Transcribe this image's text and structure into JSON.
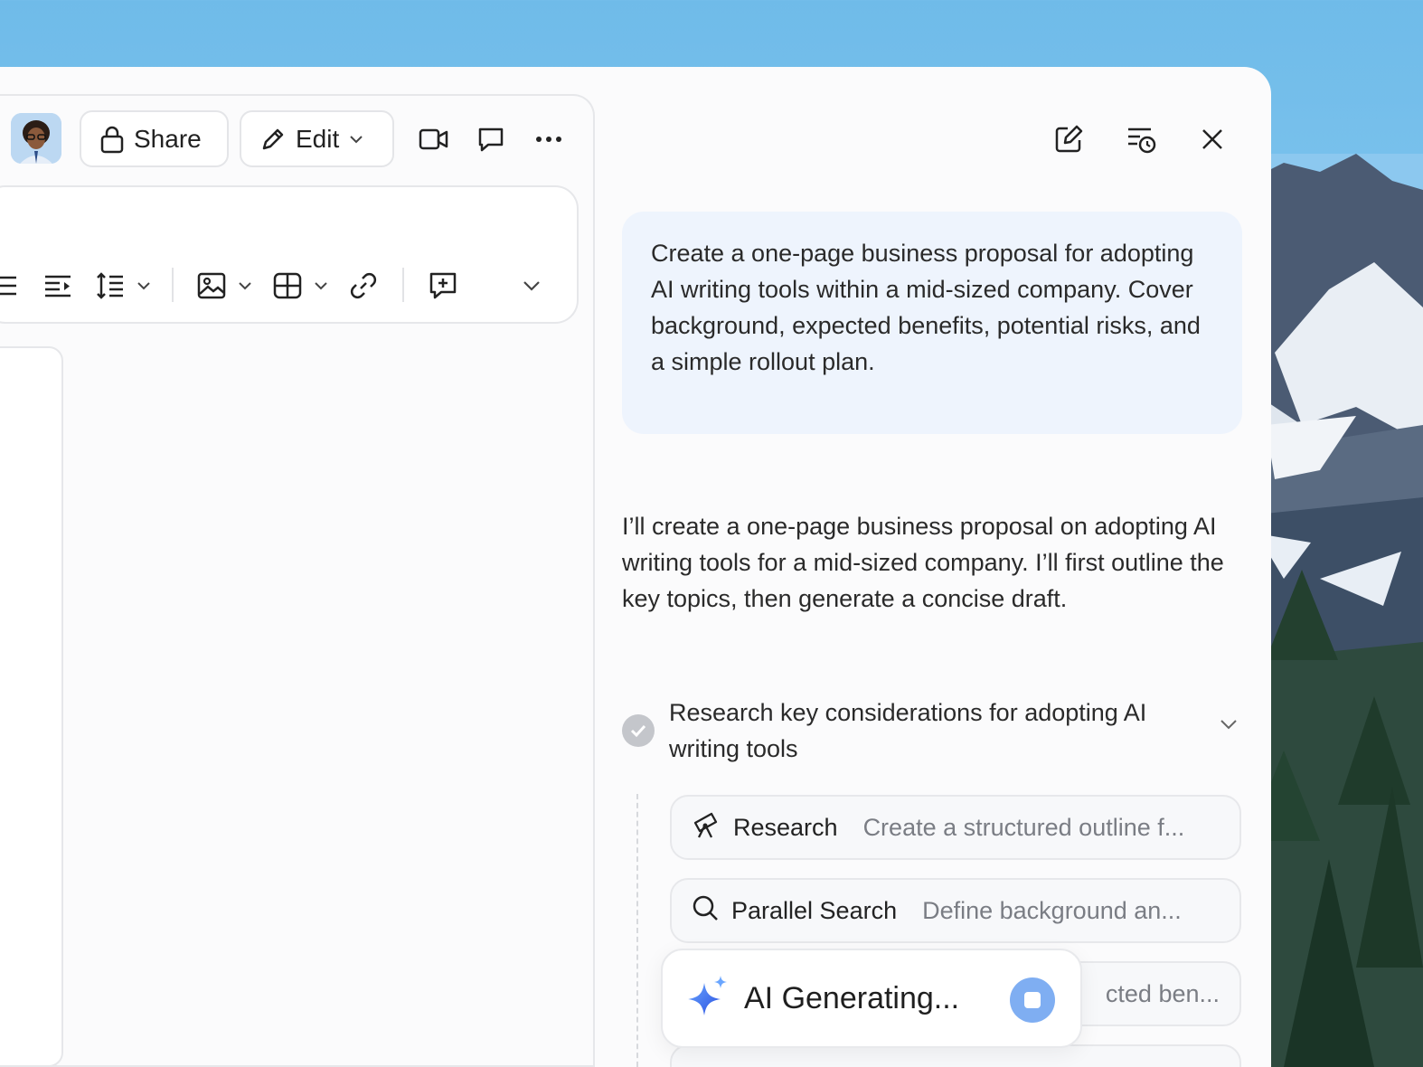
{
  "editor": {
    "share_label": "Share",
    "edit_label": "Edit"
  },
  "panel": {
    "prompt": "Create a one-page business proposal for adopting AI writing tools within a mid-sized company. Cover background, expected benefits, potential risks, and a simple rollout plan.",
    "reply": "I’ll create a one-page business proposal on adopting AI writing tools for a mid-sized company. I’ll first outline the key topics, then generate a concise draft.",
    "task_title": "Research key considerations for adopting AI writing tools",
    "steps": [
      {
        "name": "Research",
        "desc": "Create a structured outline f..."
      },
      {
        "name": "Parallel Search",
        "desc": "Define background an..."
      },
      {
        "name": "",
        "desc": "cted ben..."
      }
    ],
    "generating_label": "AI Generating..."
  },
  "colors": {
    "prompt_bg": "#eef4fd",
    "accent": "#7faef2",
    "sky": "#86c9f0"
  }
}
